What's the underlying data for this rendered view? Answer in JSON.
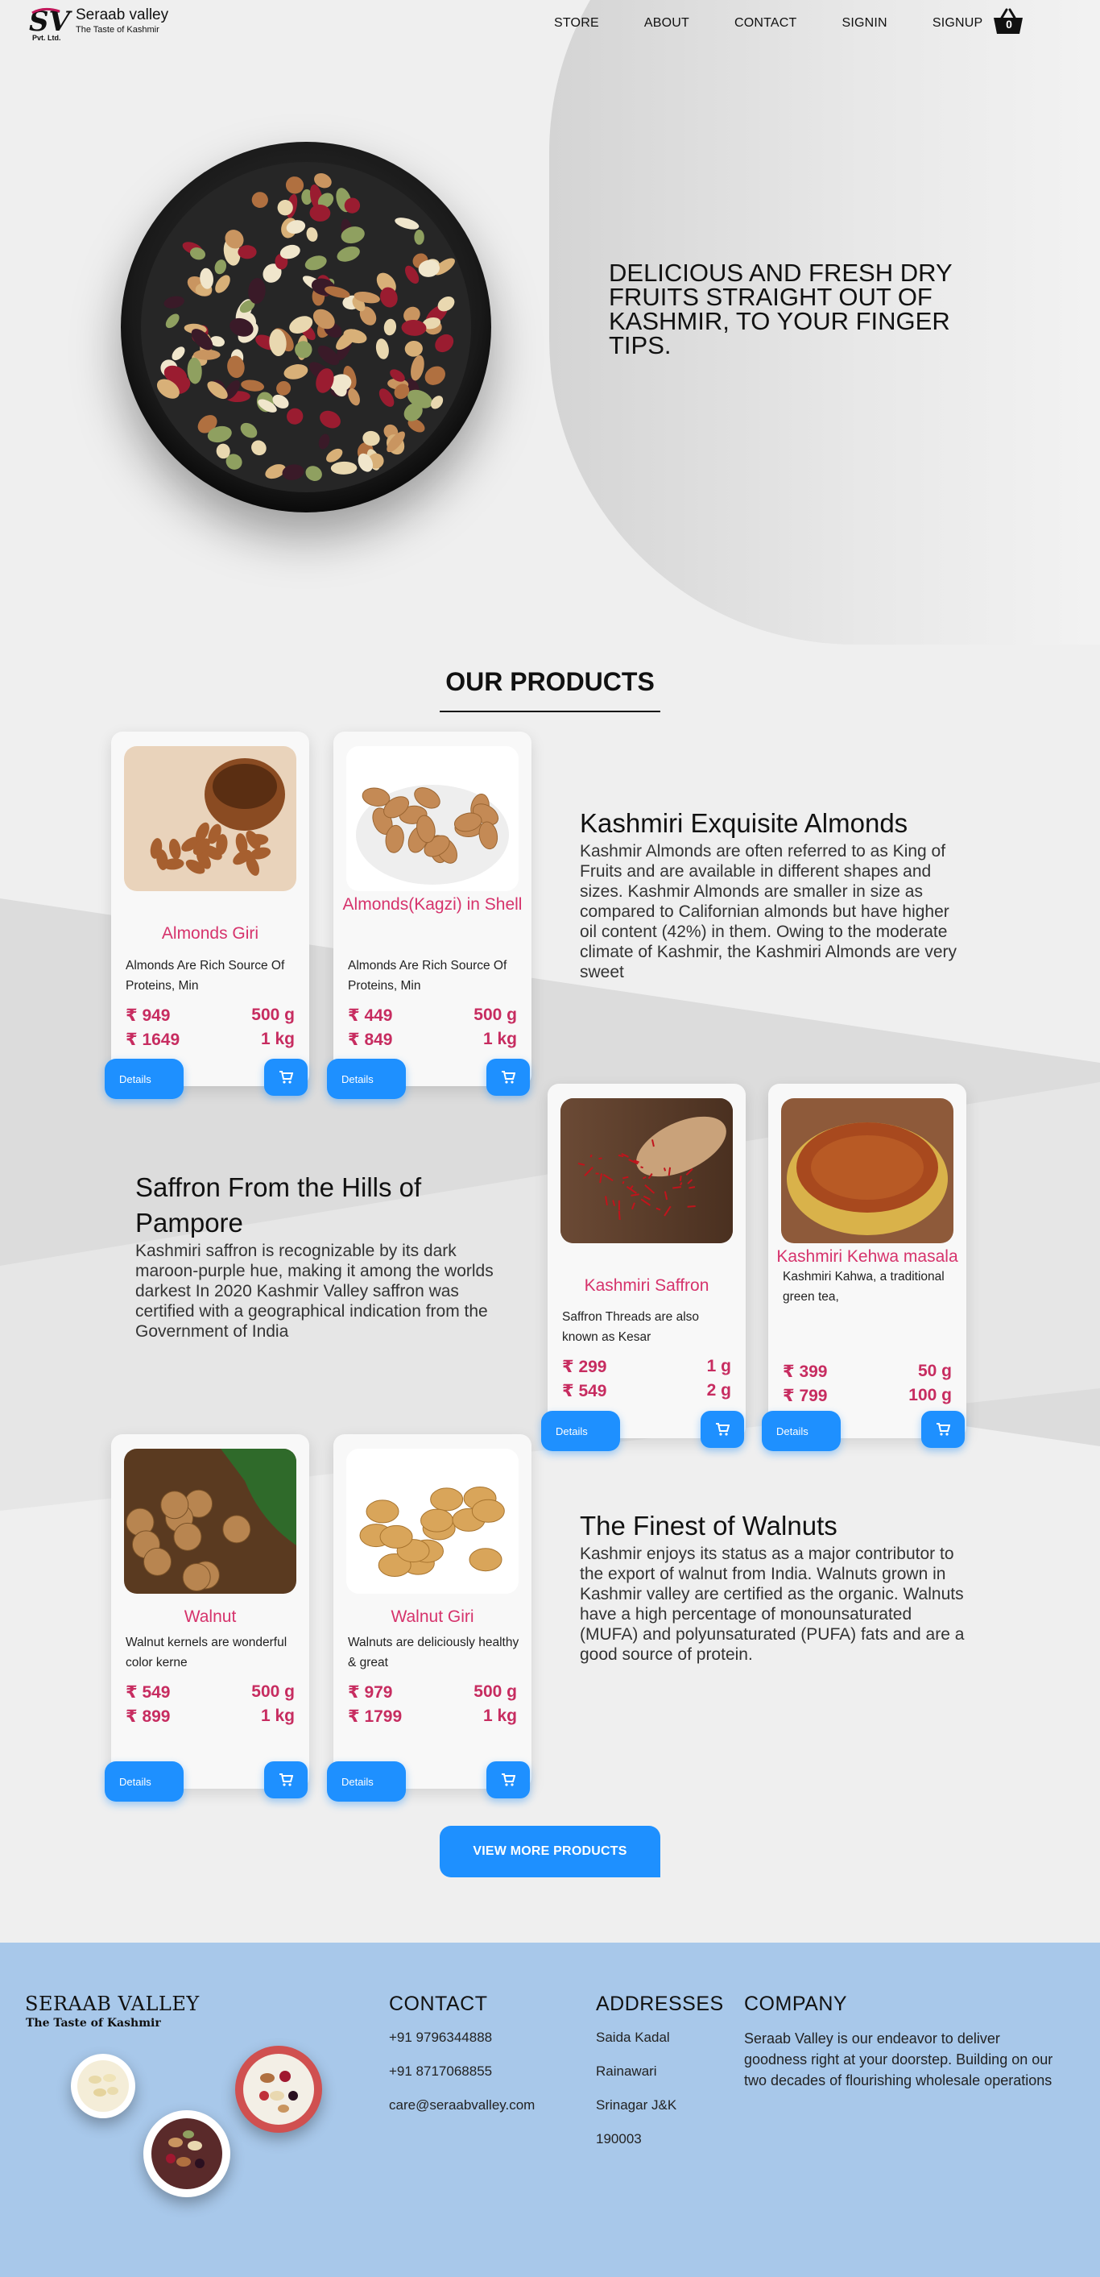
{
  "brand": {
    "name": "Seraab valley",
    "tagline": "The Taste of Kashmir",
    "mark_sub": "Pvt. Ltd.",
    "mark_letters": "SV"
  },
  "nav": {
    "links": [
      "STORE",
      "ABOUT",
      "CONTACT",
      "SIGNIN",
      "SIGNUP"
    ],
    "cart_count": "0"
  },
  "hero": {
    "title": "DELICIOUS AND FRESH DRY FRUITS STRAIGHT OUT OF KASHMIR, TO YOUR FINGER TIPS."
  },
  "products_section": {
    "title": "OUR PRODUCTS",
    "details_label": "Details",
    "view_more_label": "VIEW MORE PRODUCTS"
  },
  "products": [
    {
      "name": "Almonds Giri",
      "desc": "Almonds Are Rich Source Of Proteins, Min",
      "prices": [
        {
          "price": "₹ 949",
          "qty": "500 g"
        },
        {
          "price": "₹ 1649",
          "qty": "1 kg"
        }
      ],
      "image": "almonds-giri-image"
    },
    {
      "name": "Almonds(Kagzi) in Shell",
      "desc": "Almonds Are Rich Source Of Proteins, Min",
      "prices": [
        {
          "price": "₹ 449",
          "qty": "500 g"
        },
        {
          "price": "₹ 849",
          "qty": "1 kg"
        }
      ],
      "image": "almonds-shell-image"
    },
    {
      "name": "Kashmiri Saffron",
      "desc": "Saffron Threads are also known as Kesar",
      "prices": [
        {
          "price": "₹ 299",
          "qty": "1 g"
        },
        {
          "price": "₹ 549",
          "qty": "2 g"
        }
      ],
      "image": "saffron-image"
    },
    {
      "name": "Kashmiri Kehwa masala",
      "desc": "Kashmiri Kahwa, a traditional green tea,",
      "prices": [
        {
          "price": "₹ 399",
          "qty": "50 g"
        },
        {
          "price": "₹ 799",
          "qty": "100 g"
        }
      ],
      "image": "kehwa-image"
    },
    {
      "name": "Walnut",
      "desc": "Walnut kernels are wonderful color kerne",
      "prices": [
        {
          "price": "₹ 549",
          "qty": "500 g"
        },
        {
          "price": "₹ 899",
          "qty": "1 kg"
        }
      ],
      "image": "walnut-image"
    },
    {
      "name": "Walnut Giri",
      "desc": "Walnuts are deliciously healthy & great",
      "prices": [
        {
          "price": "₹ 979",
          "qty": "500 g"
        },
        {
          "price": "₹ 1799",
          "qty": "1 kg"
        }
      ],
      "image": "walnut-giri-image"
    }
  ],
  "features": [
    {
      "title": "Kashmiri Exquisite Almonds",
      "text": "Kashmir Almonds are often referred to as King of Fruits and are available in different shapes and sizes. Kashmir Almonds are smaller in size as compared to Californian almonds but have higher oil content (42%) in them. Owing to the moderate climate of Kashmir, the Kashmiri Almonds are very sweet"
    },
    {
      "title": "Saffron From the Hills of Pampore",
      "text": "Kashmiri saffron is recognizable by its dark maroon-purple hue, making it among the worlds darkest In 2020 Kashmir Valley saffron was certified with a geographical indication from the Government of India"
    },
    {
      "title": "The Finest of Walnuts",
      "text": "Kashmir enjoys its status as a major contributor to the export of walnut from India. Walnuts grown in Kashmir valley are certified as the organic. Walnuts have a high percentage of monounsaturated (MUFA) and polyunsaturated (PUFA) fats and are a good source of protein."
    }
  ],
  "footer": {
    "brand": "SERAAB VALLEY",
    "brand_tag": "The Taste of Kashmir",
    "contact_heading": "CONTACT",
    "contacts": [
      "+91 9796344888",
      "+91 8717068855",
      "care@seraabvalley.com"
    ],
    "addresses_heading": "ADDRESSES",
    "addresses": [
      "Saida Kadal",
      "Rainawari",
      "Srinagar J&K",
      "190003"
    ],
    "company_heading": "COMPANY",
    "company_text": "Seraab Valley is our endeavor to deliver goodness right at your doorstep. Building on our two decades of flourishing wholesale operations"
  },
  "colors": {
    "accent": "#1e90ff",
    "product_name": "#d6336c",
    "price": "#c72c60",
    "footer_bg": "#a8c8ea"
  }
}
